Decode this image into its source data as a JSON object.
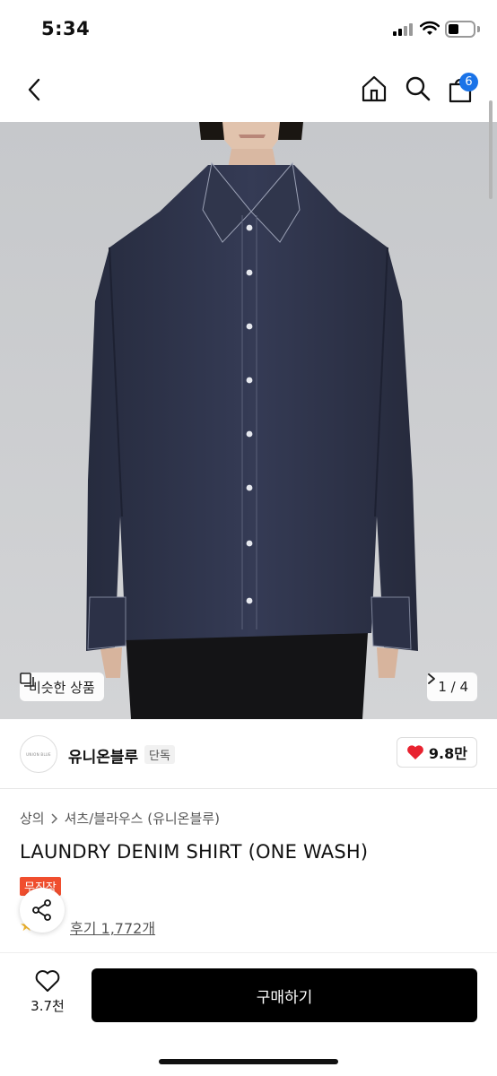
{
  "status": {
    "time": "5:34"
  },
  "nav": {
    "cart_count": "6"
  },
  "hero": {
    "similar_label": "비슷한 상품",
    "page_counter": "1 / 4"
  },
  "brand": {
    "logo_text": "UNION BLUE",
    "name": "유니온블루",
    "tag": "단독",
    "likes": "9.8만"
  },
  "breadcrumb": {
    "category": "상의",
    "subcategory": "셔츠/블라우스 (유니온블루)"
  },
  "product": {
    "title": "LAUNDRY DENIM SHIRT (ONE WASH)",
    "badge": "무진장",
    "review_link": "후기 1,772개"
  },
  "bottom": {
    "wish_count": "3.7천",
    "buy_label": "구매하기"
  },
  "colors": {
    "accent_blue": "#1a73e8",
    "heart_red": "#e8222f",
    "badge_red": "#f04e2e",
    "denim": "#2b3046"
  },
  "icons": {
    "back": "chevron-left-icon",
    "home": "home-icon",
    "search": "search-icon",
    "cart": "shopping-bag-icon",
    "similar": "similar-items-icon",
    "next": "chevron-right-icon",
    "like": "heart-icon",
    "share": "share-icon",
    "wish": "heart-outline-icon"
  }
}
